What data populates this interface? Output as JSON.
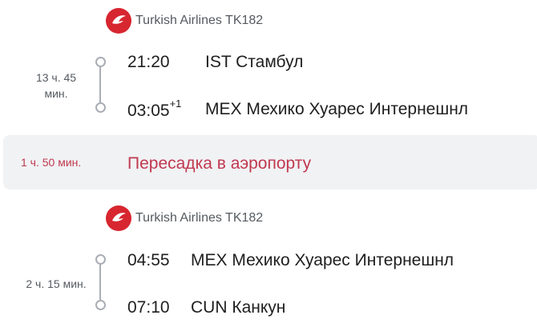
{
  "segments": [
    {
      "airline": "Turkish Airlines TK182",
      "duration": "13 ч. 45 мин.",
      "departure": {
        "time": "21:20",
        "day_offset": "",
        "place": "IST Стамбул"
      },
      "arrival": {
        "time": "03:05",
        "day_offset": "+1",
        "place": "MEX Мехико Хуарес Интернешнл"
      }
    },
    {
      "airline": "Turkish Airlines TK182",
      "duration": "2 ч. 15 мин.",
      "departure": {
        "time": "04:55",
        "day_offset": "",
        "place": "MEX Мехико Хуарес Интернешнл"
      },
      "arrival": {
        "time": "07:10",
        "day_offset": "",
        "place": "CUN Канкун"
      }
    }
  ],
  "transfer": {
    "duration": "1 ч. 50 мин.",
    "label": "Пересадка в аэропорту"
  },
  "colors": {
    "brand_red": "#d7262f",
    "transfer_text": "#c0394f",
    "band_bg": "#f1f2f4",
    "timeline": "#a9adb4"
  },
  "icons": {
    "airline_logo": "turkish-airlines-logo-icon"
  }
}
